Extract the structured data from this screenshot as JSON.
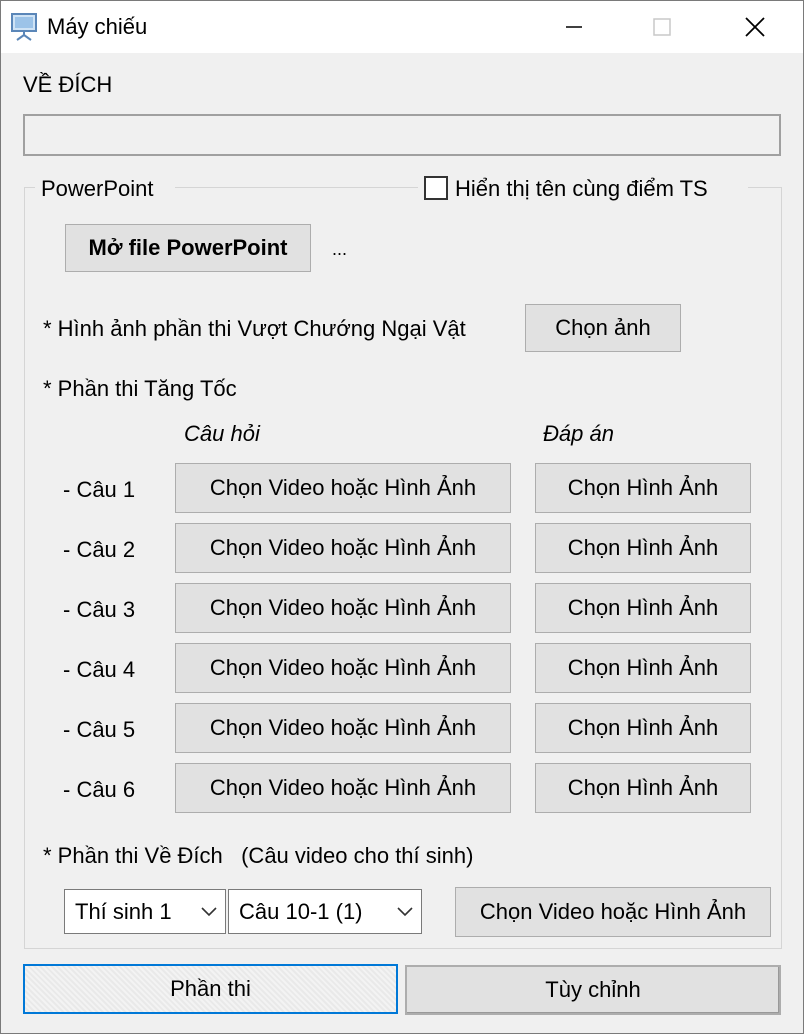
{
  "window": {
    "title": "Máy chiếu"
  },
  "header_label": "VỀ ĐÍCH",
  "path_field": {
    "value": ""
  },
  "powerpoint_group": {
    "label": "PowerPoint",
    "show_names_checkbox": {
      "label": "Hiển thị tên cùng điểm TS",
      "checked": false
    },
    "open_button": "Mở file PowerPoint",
    "file_name": "..."
  },
  "vcnv": {
    "label": "* Hình ảnh phần thi Vượt Chướng Ngại Vật",
    "button": "Chọn ảnh"
  },
  "tangtoc": {
    "label": "* Phần thi Tăng Tốc",
    "col_question": "Câu hỏi",
    "col_answer": "Đáp án",
    "rows": [
      {
        "label": "- Câu 1",
        "question_button": "Chọn Video hoặc Hình Ảnh",
        "answer_button": "Chọn Hình Ảnh"
      },
      {
        "label": "- Câu 2",
        "question_button": "Chọn Video hoặc Hình Ảnh",
        "answer_button": "Chọn Hình Ảnh"
      },
      {
        "label": "- Câu 3",
        "question_button": "Chọn Video hoặc Hình Ảnh",
        "answer_button": "Chọn Hình Ảnh"
      },
      {
        "label": "- Câu 4",
        "question_button": "Chọn Video hoặc Hình Ảnh",
        "answer_button": "Chọn Hình Ảnh"
      },
      {
        "label": "- Câu 5",
        "question_button": "Chọn Video hoặc Hình Ảnh",
        "answer_button": "Chọn Hình Ảnh"
      },
      {
        "label": "- Câu 6",
        "question_button": "Chọn Video hoặc Hình Ảnh",
        "answer_button": "Chọn Hình Ảnh"
      }
    ]
  },
  "vedich": {
    "label": "* Phần thi Về Đích   (Câu video cho thí sinh)",
    "contestant_select": "Thí sinh 1",
    "question_select": "Câu 10-1 (1)",
    "button": "Chọn Video hoặc Hình Ảnh"
  },
  "tabs": {
    "round": "Phần thi",
    "custom": "Tùy chỉnh"
  },
  "colors": {
    "accent": "#0078d7",
    "button_bg": "#e1e1e1",
    "window_bg": "#f0f0f0"
  }
}
